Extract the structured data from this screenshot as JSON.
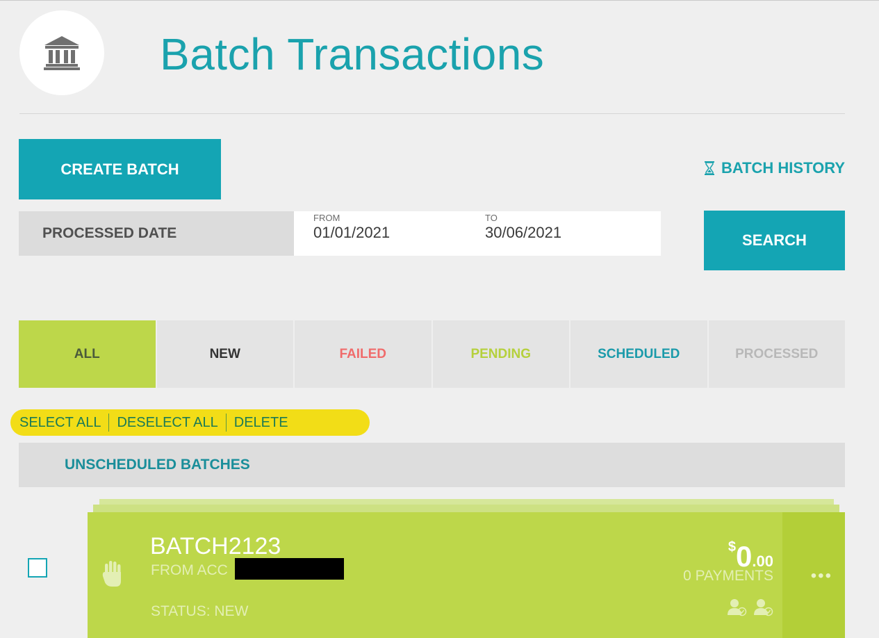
{
  "header": {
    "title": "Batch Transactions",
    "logo_icon": "bank-building-icon"
  },
  "actions": {
    "create_batch_label": "CREATE BATCH",
    "batch_history_label": "BATCH HISTORY",
    "batch_history_icon": "hourglass-icon"
  },
  "filter": {
    "label": "PROCESSED DATE",
    "from_caption": "FROM",
    "from_value": "01/01/2021",
    "to_caption": "TO",
    "to_value": "30/06/2021",
    "search_label": "SEARCH"
  },
  "tabs": [
    {
      "label": "ALL",
      "color": "#4a5a3a",
      "active": true
    },
    {
      "label": "NEW",
      "color": "#333333",
      "active": false
    },
    {
      "label": "FAILED",
      "color": "#f06b6b",
      "active": false
    },
    {
      "label": "PENDING",
      "color": "#b5d03c",
      "active": false
    },
    {
      "label": "SCHEDULED",
      "color": "#1a9aaa",
      "active": false
    },
    {
      "label": "PROCESSED",
      "color": "#b8b8b8",
      "active": false
    }
  ],
  "bulk": {
    "select_all": "SELECT ALL",
    "deselect_all": "DESELECT ALL",
    "delete": "DELETE"
  },
  "group": {
    "title": "UNSCHEDULED BATCHES"
  },
  "batch": {
    "name": "BATCH2123",
    "from_account": "FROM ACC",
    "status": "STATUS: NEW",
    "amount_currency": "$",
    "amount_main": "0",
    "amount_cents": ".00",
    "payments": "0 PAYMENTS",
    "hold_icon": "hand-icon",
    "approver_icons": [
      "approver-icon",
      "approver-icon"
    ],
    "more_icon": "more-options-icon"
  },
  "colors": {
    "accent": "#14a5b4",
    "title": "#1aa2ad",
    "active_tab": "#bdd74a",
    "card": "#bdd74a",
    "highlight": "#f2dd17"
  }
}
